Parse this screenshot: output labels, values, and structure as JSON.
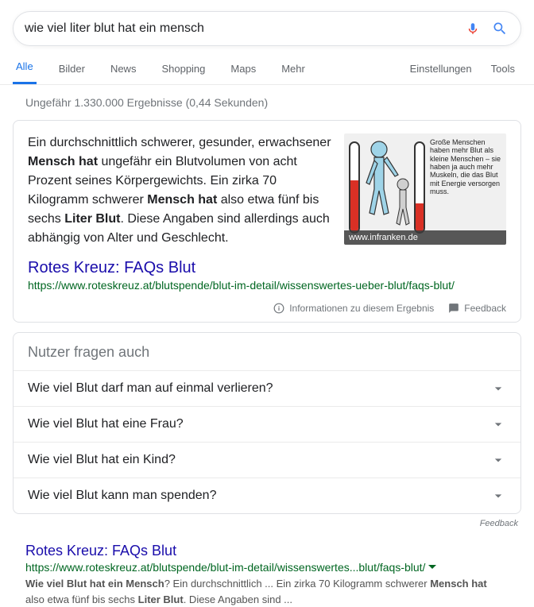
{
  "search": {
    "query": "wie viel liter blut hat ein mensch"
  },
  "tabs": {
    "all": "Alle",
    "images": "Bilder",
    "news": "News",
    "shopping": "Shopping",
    "maps": "Maps",
    "more": "Mehr",
    "settings": "Einstellungen",
    "tools": "Tools"
  },
  "stats": "Ungefähr 1.330.000 Ergebnisse (0,44 Sekunden)",
  "featured": {
    "text_pre": "Ein durchschnittlich schwerer, gesunder, erwachsener ",
    "b1": "Mensch hat",
    "text_mid1": " ungefähr ein Blutvolumen von acht Prozent seines Körpergewichts. Ein zirka 70 Kilogramm schwerer ",
    "b2": "Mensch hat",
    "text_mid2": " also etwa fünf bis sechs ",
    "b3": "Liter Blut",
    "text_post": ". Diese Angaben sind allerdings auch abhängig von Alter und Geschlecht.",
    "img_caption": "www.infranken.de",
    "img_text": "Große Menschen haben mehr Blut als kleine Menschen – sie haben ja auch mehr Muskeln, die das Blut mit Energie versorgen muss.",
    "title": "Rotes Kreuz: FAQs Blut",
    "url": "https://www.roteskreuz.at/blutspende/blut-im-detail/wissenswertes-ueber-blut/faqs-blut/",
    "info": "Informationen zu diesem Ergebnis",
    "feedback": "Feedback"
  },
  "paa": {
    "heading": "Nutzer fragen auch",
    "q1": "Wie viel Blut darf man auf einmal verlieren?",
    "q2": "Wie viel Blut hat eine Frau?",
    "q3": "Wie viel Blut hat ein Kind?",
    "q4": "Wie viel Blut kann man spenden?"
  },
  "feedback": "Feedback",
  "result1": {
    "title": "Rotes Kreuz: FAQs Blut",
    "url": "https://www.roteskreuz.at/blutspende/blut-im-detail/wissenswertes...blut/faqs-blut/",
    "d_b1": "Wie viel Blut hat ein Mensch",
    "d_m1": "? Ein durchschnittlich ... Ein zirka 70 Kilogramm schwerer ",
    "d_b2": "Mensch hat",
    "d_m2": " also etwa fünf bis sechs ",
    "d_b3": "Liter Blut",
    "d_m3": ". Diese Angaben sind ..."
  }
}
